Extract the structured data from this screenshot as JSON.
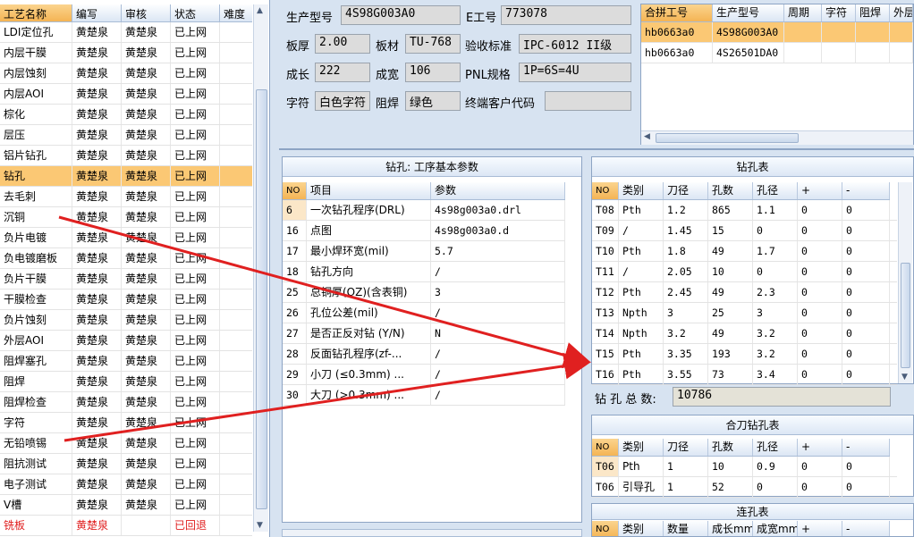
{
  "left_list": {
    "headers": [
      "工艺名称",
      "编写",
      "审核",
      "状态",
      "难度"
    ],
    "rows": [
      {
        "name": "LDI定位孔",
        "writer": "黄楚泉",
        "reviewer": "黄楚泉",
        "status": "已上网",
        "difficulty": ""
      },
      {
        "name": "内层干膜",
        "writer": "黄楚泉",
        "reviewer": "黄楚泉",
        "status": "已上网",
        "difficulty": ""
      },
      {
        "name": "内层蚀刻",
        "writer": "黄楚泉",
        "reviewer": "黄楚泉",
        "status": "已上网",
        "difficulty": ""
      },
      {
        "name": "内层AOI",
        "writer": "黄楚泉",
        "reviewer": "黄楚泉",
        "status": "已上网",
        "difficulty": ""
      },
      {
        "name": "棕化",
        "writer": "黄楚泉",
        "reviewer": "黄楚泉",
        "status": "已上网",
        "difficulty": ""
      },
      {
        "name": "层压",
        "writer": "黄楚泉",
        "reviewer": "黄楚泉",
        "status": "已上网",
        "difficulty": ""
      },
      {
        "name": "铝片钻孔",
        "writer": "黄楚泉",
        "reviewer": "黄楚泉",
        "status": "已上网",
        "difficulty": ""
      },
      {
        "name": "钻孔",
        "writer": "黄楚泉",
        "reviewer": "黄楚泉",
        "status": "已上网",
        "difficulty": ""
      },
      {
        "name": "去毛刺",
        "writer": "黄楚泉",
        "reviewer": "黄楚泉",
        "status": "已上网",
        "difficulty": ""
      },
      {
        "name": "沉铜",
        "writer": "黄楚泉",
        "reviewer": "黄楚泉",
        "status": "已上网",
        "difficulty": ""
      },
      {
        "name": "负片电镀",
        "writer": "黄楚泉",
        "reviewer": "黄楚泉",
        "status": "已上网",
        "difficulty": ""
      },
      {
        "name": "负电镀磨板",
        "writer": "黄楚泉",
        "reviewer": "黄楚泉",
        "status": "已上网",
        "difficulty": ""
      },
      {
        "name": "负片干膜",
        "writer": "黄楚泉",
        "reviewer": "黄楚泉",
        "status": "已上网",
        "difficulty": ""
      },
      {
        "name": "干膜检查",
        "writer": "黄楚泉",
        "reviewer": "黄楚泉",
        "status": "已上网",
        "difficulty": ""
      },
      {
        "name": "负片蚀刻",
        "writer": "黄楚泉",
        "reviewer": "黄楚泉",
        "status": "已上网",
        "difficulty": ""
      },
      {
        "name": "外层AOI",
        "writer": "黄楚泉",
        "reviewer": "黄楚泉",
        "status": "已上网",
        "difficulty": ""
      },
      {
        "name": "阻焊塞孔",
        "writer": "黄楚泉",
        "reviewer": "黄楚泉",
        "status": "已上网",
        "difficulty": ""
      },
      {
        "name": "阻焊",
        "writer": "黄楚泉",
        "reviewer": "黄楚泉",
        "status": "已上网",
        "difficulty": ""
      },
      {
        "name": "阻焊检查",
        "writer": "黄楚泉",
        "reviewer": "黄楚泉",
        "status": "已上网",
        "difficulty": ""
      },
      {
        "name": "字符",
        "writer": "黄楚泉",
        "reviewer": "黄楚泉",
        "status": "已上网",
        "difficulty": ""
      },
      {
        "name": "无铅喷锡",
        "writer": "黄楚泉",
        "reviewer": "黄楚泉",
        "status": "已上网",
        "difficulty": ""
      },
      {
        "name": "阻抗测试",
        "writer": "黄楚泉",
        "reviewer": "黄楚泉",
        "status": "已上网",
        "difficulty": ""
      },
      {
        "name": "电子测试",
        "writer": "黄楚泉",
        "reviewer": "黄楚泉",
        "status": "已上网",
        "difficulty": ""
      },
      {
        "name": "V槽",
        "writer": "黄楚泉",
        "reviewer": "黄楚泉",
        "status": "已上网",
        "difficulty": ""
      },
      {
        "name": "铣板",
        "writer": "黄楚泉",
        "reviewer": "",
        "status": "已回退",
        "difficulty": ""
      }
    ],
    "selected_index": 7,
    "red_index": 24
  },
  "form": {
    "prod_model_label": "生产型号",
    "prod_model": "4S98G003A0",
    "e_no_label": "E工号",
    "e_no": "773078",
    "thickness_label": "板厚",
    "thickness": "2.00",
    "material_label": "板材",
    "material": "TU-768",
    "accept_label": "验收标准",
    "accept": "IPC-6012 II级",
    "grow_label": "成长",
    "grow": "222",
    "width_label": "成宽",
    "width": "106",
    "pnl_label": "PNL规格",
    "pnl": "1P=6S=4U",
    "char_label": "字符",
    "char": "白色字符",
    "mask_label": "阻焊",
    "mask": "绿色",
    "customer_label": "终端客户代码",
    "customer": ""
  },
  "combine_table": {
    "headers": [
      "合拼工号",
      "生产型号",
      "周期",
      "字符",
      "阻焊",
      "外层"
    ],
    "rows": [
      [
        "hb0663a0",
        "4S98G003A0",
        "",
        "",
        "",
        ""
      ],
      [
        "hb0663a0",
        "4S26501DA0",
        "",
        "",
        "",
        ""
      ]
    ]
  },
  "params_table": {
    "title": "钻孔: 工序基本参数",
    "headers": [
      "NO",
      "项目",
      "参数"
    ],
    "rows": [
      [
        "6",
        "一次钻孔程序(DRL)",
        "4s98g003a0.drl"
      ],
      [
        "16",
        "点图",
        "4s98g003a0.d"
      ],
      [
        "17",
        "最小焊环宽(mil)",
        "5.7"
      ],
      [
        "18",
        "钻孔方向",
        "/"
      ],
      [
        "25",
        "总铜厚(OZ)(含表铜)",
        "3"
      ],
      [
        "26",
        "孔位公差(mil)",
        "/"
      ],
      [
        "27",
        "是否正反对钻 (Y/N)",
        "N"
      ],
      [
        "28",
        "反面钻孔程序(zf-...",
        "/"
      ],
      [
        "29",
        "小刀 (≤0.3mm) ...",
        "/"
      ],
      [
        "30",
        "大刀 (>0.3mm) ...",
        "/"
      ]
    ]
  },
  "drill_table": {
    "title": "钻孔表",
    "headers": [
      "NO",
      "类别",
      "刀径",
      "孔数",
      "孔径",
      "+",
      "-"
    ],
    "rows": [
      [
        "T08",
        "Pth",
        "1.2",
        "865",
        "1.1",
        "0",
        "0"
      ],
      [
        "T09",
        "/",
        "1.45",
        "15",
        "0",
        "0",
        "0"
      ],
      [
        "T10",
        "Pth",
        "1.8",
        "49",
        "1.7",
        "0",
        "0"
      ],
      [
        "T11",
        "/",
        "2.05",
        "10",
        "0",
        "0",
        "0"
      ],
      [
        "T12",
        "Pth",
        "2.45",
        "49",
        "2.3",
        "0",
        "0"
      ],
      [
        "T13",
        "Npth",
        "3",
        "25",
        "3",
        "0",
        "0"
      ],
      [
        "T14",
        "Npth",
        "3.2",
        "49",
        "3.2",
        "0",
        "0"
      ],
      [
        "T15",
        "Pth",
        "3.35",
        "193",
        "3.2",
        "0",
        "0"
      ],
      [
        "T16",
        "Pth",
        "3.55",
        "73",
        "3.4",
        "0",
        "0"
      ]
    ],
    "total_label": "钻 孔 总 数:",
    "total": "10786"
  },
  "merge_table": {
    "title": "合刀钻孔表",
    "headers": [
      "NO",
      "类别",
      "刀径",
      "孔数",
      "孔径",
      "+",
      "-"
    ],
    "rows": [
      [
        "T06",
        "Pth",
        "1",
        "10",
        "0.9",
        "0",
        "0"
      ],
      [
        "T06",
        "引导孔",
        "1",
        "52",
        "0",
        "0",
        "0"
      ]
    ]
  },
  "conn_table": {
    "title": "连孔表",
    "headers": [
      "NO",
      "类别",
      "数量",
      "成长mm",
      "成宽mm",
      "+",
      "-"
    ]
  },
  "colors": {
    "selected_row": "#fbc874",
    "arrow": "#e02020",
    "status_rollback": "#e02020"
  }
}
